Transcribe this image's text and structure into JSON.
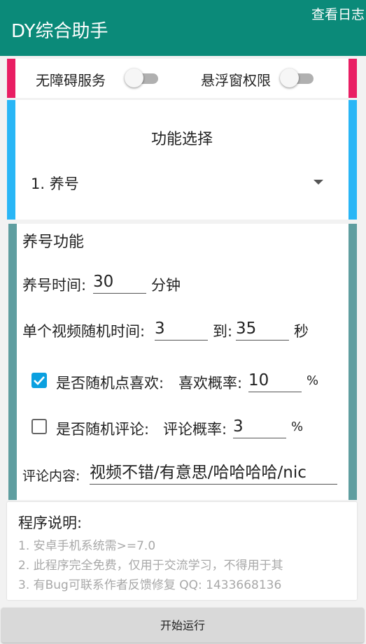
{
  "appbar": {
    "title": "DY综合助手",
    "log_button": "查看日志"
  },
  "permissions": {
    "accessibility_label": "无障碍服务",
    "accessibility_enabled": false,
    "overlay_label": "悬浮窗权限",
    "overlay_enabled": false
  },
  "function_select": {
    "title": "功能选择",
    "selected": "1. 养号"
  },
  "settings": {
    "title": "养号功能",
    "duration_label": "养号时间:",
    "duration_value": "30",
    "duration_unit": "分钟",
    "video_time_label": "单个视频随机时间:",
    "video_time_min": "3",
    "video_time_to": "到:",
    "video_time_max": "35",
    "video_time_unit": "秒",
    "like_checked": true,
    "like_label": "是否随机点喜欢:",
    "like_rate_label": "喜欢概率:",
    "like_rate_value": "10",
    "like_rate_unit": "%",
    "comment_checked": false,
    "comment_label": "是否随机评论:",
    "comment_rate_label": "评论概率:",
    "comment_rate_value": "3",
    "comment_rate_unit": "%",
    "comment_content_label": "评论内容:",
    "comment_content_value": "视频不错/有意思/哈哈哈哈/nic"
  },
  "description": {
    "title": "程序说明:",
    "lines": [
      "1. 安卓手机系统需>=7.0",
      "2. 此程序完全免费，仅用于交流学习，不得用于其",
      "3. 有Bug可联系作者反馈修复 QQ: 1433668136"
    ]
  },
  "start_button": "开始运行",
  "colors": {
    "appbar": "#0b8a79",
    "permissions_accent": "#e91e63",
    "function_accent": "#29b6f6",
    "settings_accent": "#5f9ea0",
    "checkbox_on": "#0aa0e0"
  }
}
